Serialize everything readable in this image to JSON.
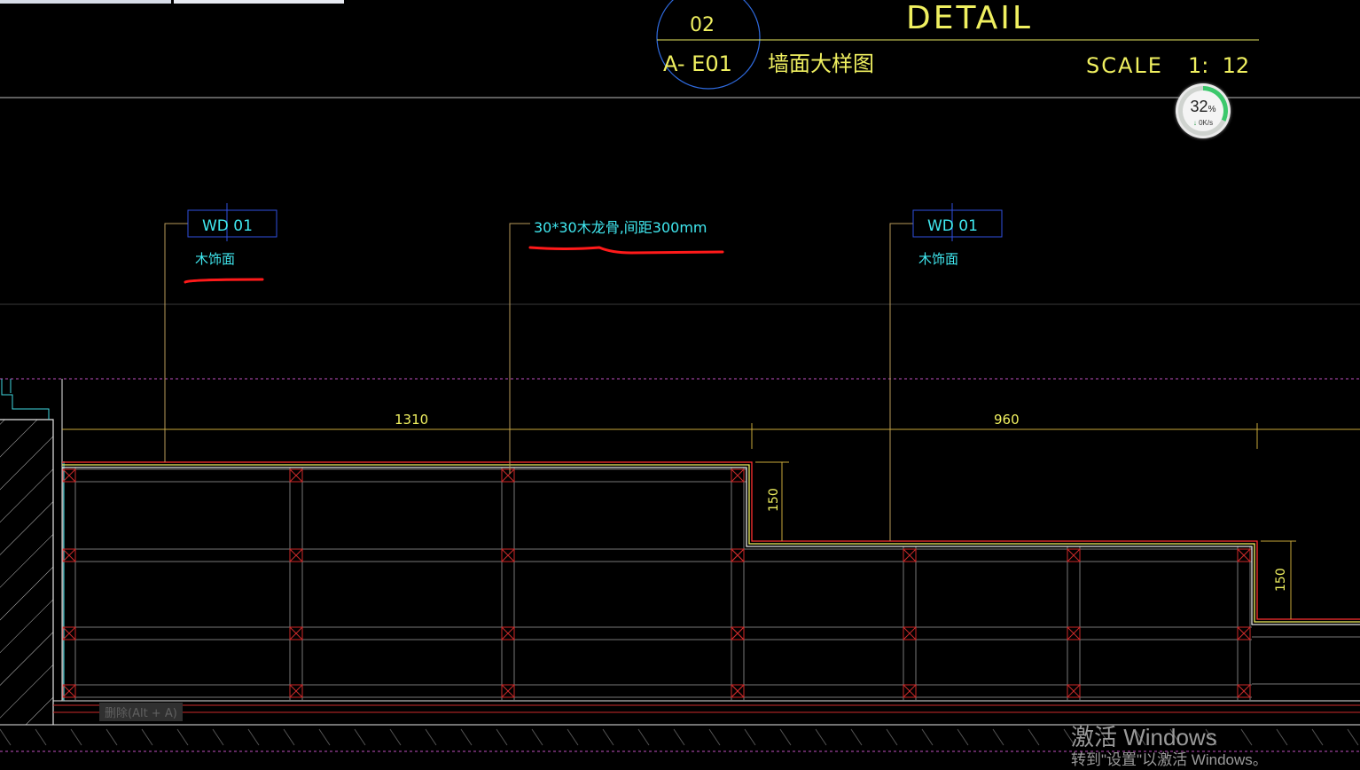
{
  "tabs": [
    {
      "label": ""
    },
    {
      "label": ""
    }
  ],
  "title_block": {
    "detail_number": "02",
    "sheet_ref": "A- E01",
    "detail_heading": "DETAIL",
    "detail_name": "墙面大样图",
    "scale_label": "SCALE",
    "scale_value": "1:  12"
  },
  "annotations": {
    "left_tag": "WD 01",
    "left_desc": "木饰面",
    "middle_note": "30*30木龙骨,间距300mm",
    "right_tag": "WD 01",
    "right_desc": "木饰面"
  },
  "dimensions": {
    "width_left": "1310",
    "width_right": "960",
    "height_step_1": "150",
    "height_step_2": "150"
  },
  "progress": {
    "value_percent": 32,
    "value_text": "32",
    "unit": "%",
    "arrow": "↓",
    "speed": "0K/s"
  },
  "watermark": {
    "title": "激活 Windows",
    "subtitle": "转到\"设置\"以激活 Windows。"
  },
  "tooltip": {
    "text": "删除(Alt + A)"
  },
  "colors": {
    "background": "#000000",
    "annotation_text": "#40e8f0",
    "title_text": "#f0f060",
    "markup_red": "#ff1a1a",
    "frame_red": "#cc2a2a",
    "layer_magenta": "#c050c0"
  }
}
